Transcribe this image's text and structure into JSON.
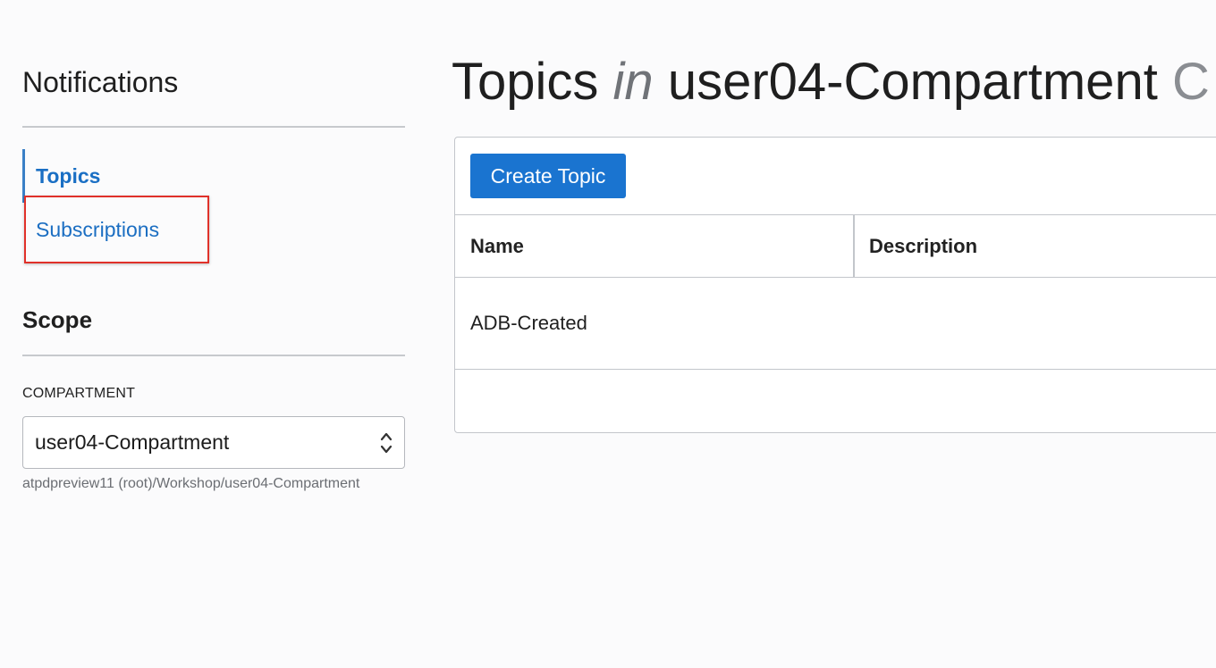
{
  "sidebar": {
    "title": "Notifications",
    "nav": [
      {
        "label": "Topics",
        "active": true
      },
      {
        "label": "Subscriptions",
        "active": false,
        "highlighted": true
      }
    ],
    "scope_title": "Scope",
    "compartment_label": "COMPARTMENT",
    "compartment_value": "user04-Compartment",
    "compartment_path": "atpdpreview11 (root)/Workshop/user04-Compartment"
  },
  "main": {
    "title_prefix": "Topics",
    "title_in": "in",
    "title_compartment": "user04-Compartment",
    "title_trailing": "C",
    "create_button": "Create Topic",
    "table": {
      "columns": [
        "Name",
        "Description"
      ],
      "rows": [
        {
          "name": "ADB-Created",
          "description": ""
        }
      ]
    }
  },
  "colors": {
    "accent": "#1a74d0",
    "link": "#1b6ec2",
    "highlight": "#e0312a",
    "border": "#c3c6cb"
  },
  "icons": {
    "select_arrows": "chevron-up-down-icon"
  }
}
